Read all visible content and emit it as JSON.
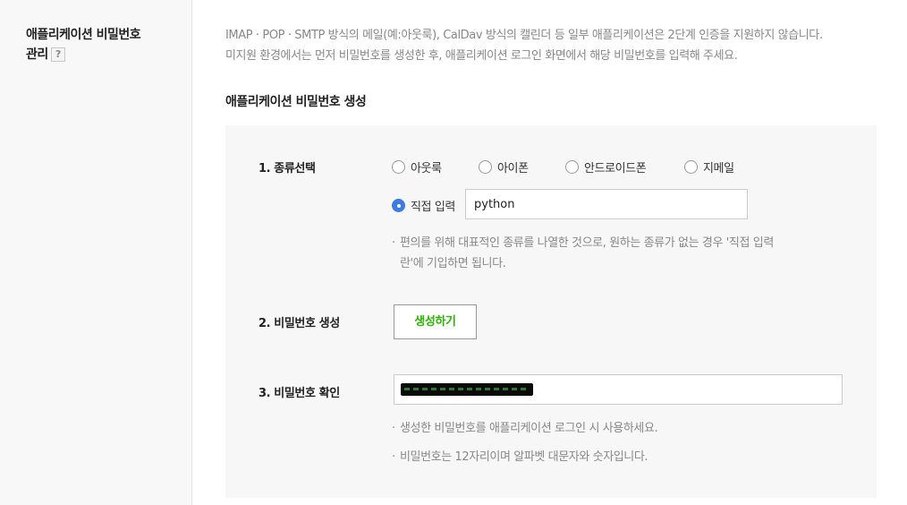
{
  "sidebar": {
    "title_line1": "애플리케이션 비밀번호",
    "title_line2": "관리",
    "help_label": "?"
  },
  "description": {
    "line1": "IMAP · POP · SMTP 방식의 메일(예:아웃룩), CalDav 방식의 캘린더 등 일부 애플리케이션은 2단계 인증을 지원하지 않습니다.",
    "line2": "미지원 환경에서는 먼저 비밀번호를 생성한 후, 애플리케이션 로그인 화면에서 해당 비밀번호를 입력해 주세요."
  },
  "subheading": "애플리케이션 비밀번호 생성",
  "step1": {
    "label": "1. 종류선택",
    "options": [
      {
        "label": "아웃룩",
        "selected": false
      },
      {
        "label": "아이폰",
        "selected": false
      },
      {
        "label": "안드로이드폰",
        "selected": false
      },
      {
        "label": "지메일",
        "selected": false
      },
      {
        "label": "직접 입력",
        "selected": true
      }
    ],
    "custom_value": "python",
    "note_line1": "편의를 위해 대표적인 종류를 나열한 것으로, 원하는 종류가 없는 경우 '직접 입력",
    "note_line2": "란'에 기입하면 됩니다."
  },
  "step2": {
    "label": "2. 비밀번호 생성",
    "button": "생성하기"
  },
  "step3": {
    "label": "3. 비밀번호 확인",
    "note1": "생성한 비밀번호를 애플리케이션 로그인 시 사용하세요.",
    "note2": "비밀번호는 12자리이며 알파벳 대문자와 숫자입니다."
  },
  "colors": {
    "accent_blue": "#3d7be3",
    "button_green": "#2db400",
    "panel_bg": "#f7f7f7"
  }
}
